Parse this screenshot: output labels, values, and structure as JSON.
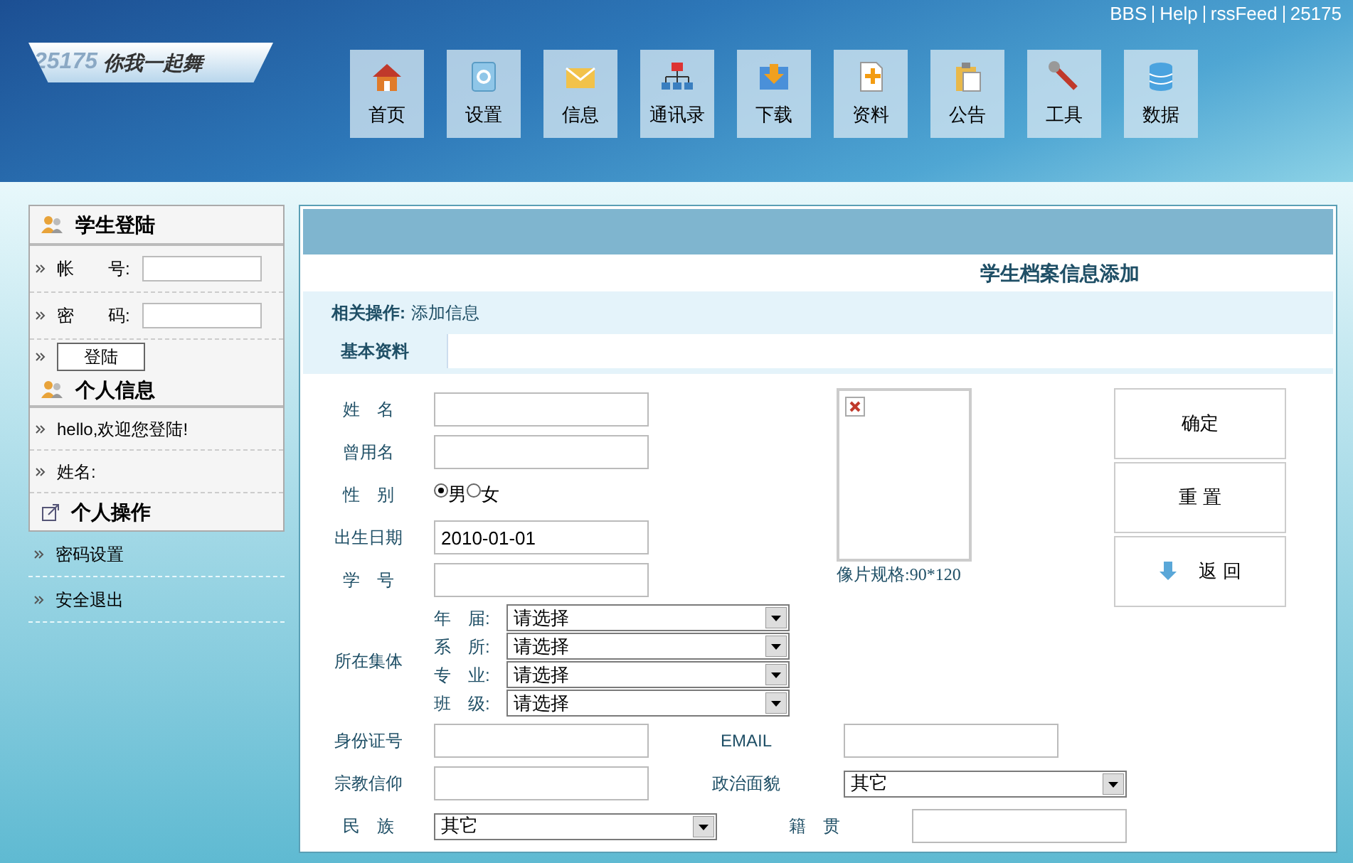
{
  "top_links": [
    "BBS",
    "Help",
    "rssFeed",
    "25175"
  ],
  "logo": {
    "number": "25175",
    "slogan": "你我一起舞"
  },
  "nav": [
    {
      "label": "首页",
      "selected": false
    },
    {
      "label": "设置",
      "selected": false
    },
    {
      "label": "信息",
      "selected": false
    },
    {
      "label": "通讯录",
      "selected": false
    },
    {
      "label": "下载",
      "selected": false
    },
    {
      "label": "资料",
      "selected": false
    },
    {
      "label": "公告",
      "selected": false
    },
    {
      "label": "工具",
      "selected": false
    },
    {
      "label": "数据",
      "selected": false
    }
  ],
  "sidebar": {
    "login": {
      "title": "学生登陆",
      "fields": [
        {
          "label": "帐　　号:"
        },
        {
          "label": "密　　码:"
        }
      ],
      "button": "登陆"
    },
    "info": {
      "title": "个人信息",
      "lines": [
        "hello,欢迎您登陆!",
        "姓名:"
      ]
    },
    "ops": {
      "title": "个人操作",
      "links": [
        "密码设置",
        "安全退出"
      ]
    }
  },
  "main": {
    "title": "学生档案信息添加",
    "ops_label": "相关操作:",
    "ops_link": "添加信息",
    "tabs": [
      {
        "label": "基本资料",
        "selected": true
      }
    ],
    "fields": [
      {
        "kind": "text",
        "label": "姓　名"
      },
      {
        "kind": "text",
        "label": "曾用名"
      },
      {
        "kind": "radio",
        "label": "性　别",
        "options": [
          {
            "label": "男",
            "selected": true
          },
          {
            "label": "女",
            "selected": false
          }
        ]
      },
      {
        "kind": "text",
        "label": "出生日期",
        "value": "2010-01-01"
      },
      {
        "kind": "text",
        "label": "学　号"
      },
      {
        "kind": "group",
        "label": "所在集体",
        "selects": [
          {
            "label": "年　届:",
            "value": "请选择"
          },
          {
            "label": "系　所:",
            "value": "请选择"
          },
          {
            "label": "专　业:",
            "value": "请选择"
          },
          {
            "label": "班　级:",
            "value": "请选择"
          }
        ]
      }
    ],
    "photo": {
      "caption": "像片规格:90*120"
    },
    "buttons": [
      {
        "label": "确定",
        "kind": "plain"
      },
      {
        "label": "重 置",
        "kind": "plain"
      },
      {
        "label": "返 回",
        "kind": "arrow"
      }
    ],
    "pairs": [
      [
        {
          "label": "身份证号",
          "kind": "text"
        },
        {
          "label": "EMAIL",
          "kind": "text"
        }
      ],
      [
        {
          "label": "宗教信仰",
          "kind": "text"
        },
        {
          "label": "政治面貌",
          "kind": "select",
          "value": "其它"
        }
      ],
      [
        {
          "label": "民　族",
          "kind": "select",
          "value": "其它"
        },
        {
          "label": "籍　贯",
          "kind": "text"
        }
      ]
    ]
  }
}
